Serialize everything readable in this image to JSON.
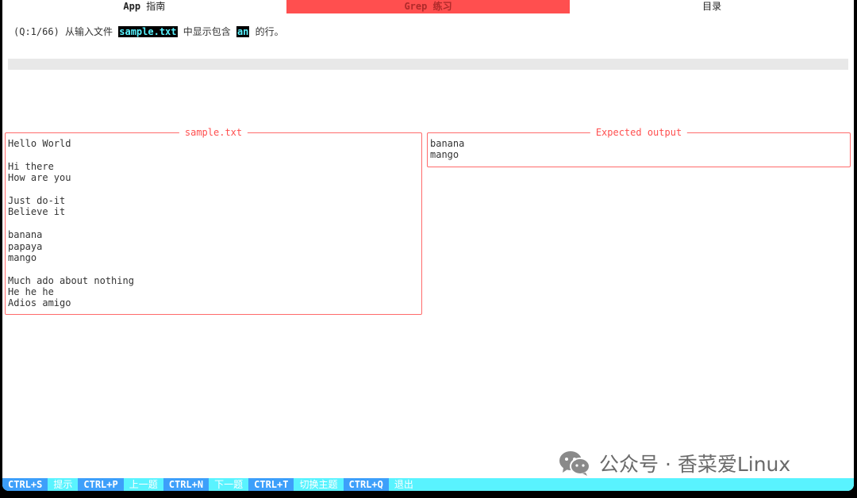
{
  "tabs": [
    {
      "label_bold": "App",
      "label_rest": " 指南"
    },
    {
      "label_bold": "Grep",
      "label_rest": " 练习"
    },
    {
      "label_bold": "",
      "label_rest": "目录"
    }
  ],
  "question": {
    "prefix": "(Q:1/66) 从输入文件 ",
    "file": "sample.txt",
    "middle": " 中显示包含 ",
    "pattern": "an",
    "suffix": " 的行。"
  },
  "input": {
    "value": ""
  },
  "file_panel": {
    "title": "sample.txt",
    "lines": [
      "Hello World",
      "",
      "Hi there",
      "How are you",
      "",
      "Just do-it",
      "Believe it",
      "",
      "banana",
      "papaya",
      "mango",
      "",
      "Much ado about nothing",
      "He he he",
      "Adios amigo"
    ]
  },
  "expected_panel": {
    "title": "Expected output",
    "lines": [
      "banana",
      "mango"
    ]
  },
  "watermark": {
    "text": "公众号 · 香菜爱Linux"
  },
  "statusbar": [
    {
      "key": "CTRL+S",
      "label": "提示"
    },
    {
      "key": "CTRL+P",
      "label": "上一题"
    },
    {
      "key": "CTRL+N",
      "label": "下一题"
    },
    {
      "key": "CTRL+T",
      "label": "切换主题"
    },
    {
      "key": "CTRL+Q",
      "label": "退出"
    }
  ],
  "colors": {
    "accent": "#ff4f4f",
    "status_bg": "#59f3ff",
    "key_bg": "#3d9ffa"
  }
}
